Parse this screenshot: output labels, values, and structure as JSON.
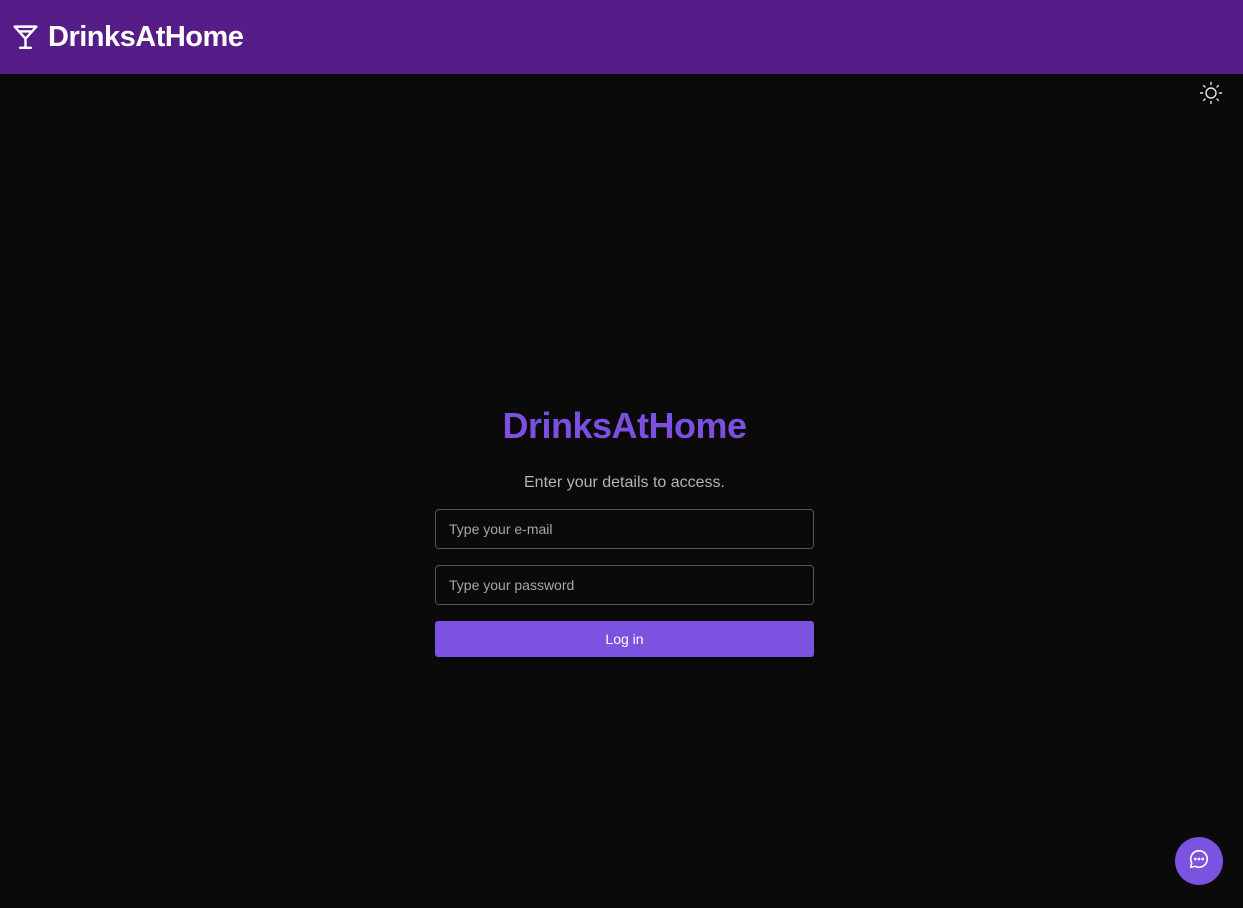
{
  "header": {
    "brand_name": "DrinksAtHome",
    "brand_icon": "cocktail-glass-icon",
    "background_color": "#561c87"
  },
  "theme_toggle": {
    "icon": "sun-icon"
  },
  "login": {
    "title": "DrinksAtHome",
    "subtitle": "Enter your details to access.",
    "email_placeholder": "Type your e-mail",
    "email_value": "",
    "password_placeholder": "Type your password",
    "password_value": "",
    "submit_label": "Log in",
    "accent_color": "#7c52e0"
  },
  "chat": {
    "icon": "chat-bubble-icon"
  },
  "page": {
    "background_color": "#0a0a0a"
  }
}
